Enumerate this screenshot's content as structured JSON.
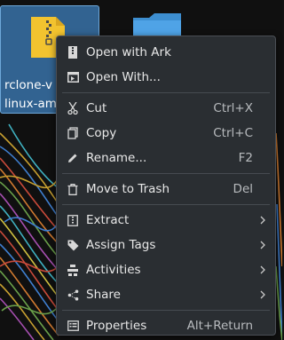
{
  "desktop": {
    "selected_icon_label_line1": "rclone-v",
    "selected_icon_label_line2": "linux-am"
  },
  "menu": {
    "items": [
      {
        "label": "Open with Ark",
        "icon": "ark-icon"
      },
      {
        "label": "Open With...",
        "icon": "open-with-icon"
      },
      {
        "label": "Cut",
        "shortcut": "Ctrl+X",
        "icon": "scissors-icon"
      },
      {
        "label": "Copy",
        "shortcut": "Ctrl+C",
        "icon": "copy-icon"
      },
      {
        "label": "Rename...",
        "shortcut": "F2",
        "icon": "pencil-icon"
      },
      {
        "label": "Move to Trash",
        "shortcut": "Del",
        "icon": "trash-icon"
      },
      {
        "label": "Extract",
        "icon": "extract-icon",
        "submenu": true
      },
      {
        "label": "Assign Tags",
        "icon": "tag-icon",
        "submenu": true
      },
      {
        "label": "Activities",
        "icon": "activities-icon",
        "submenu": true
      },
      {
        "label": "Share",
        "icon": "share-icon",
        "submenu": true
      },
      {
        "label": "Properties",
        "shortcut": "Alt+Return",
        "icon": "properties-icon"
      }
    ]
  }
}
